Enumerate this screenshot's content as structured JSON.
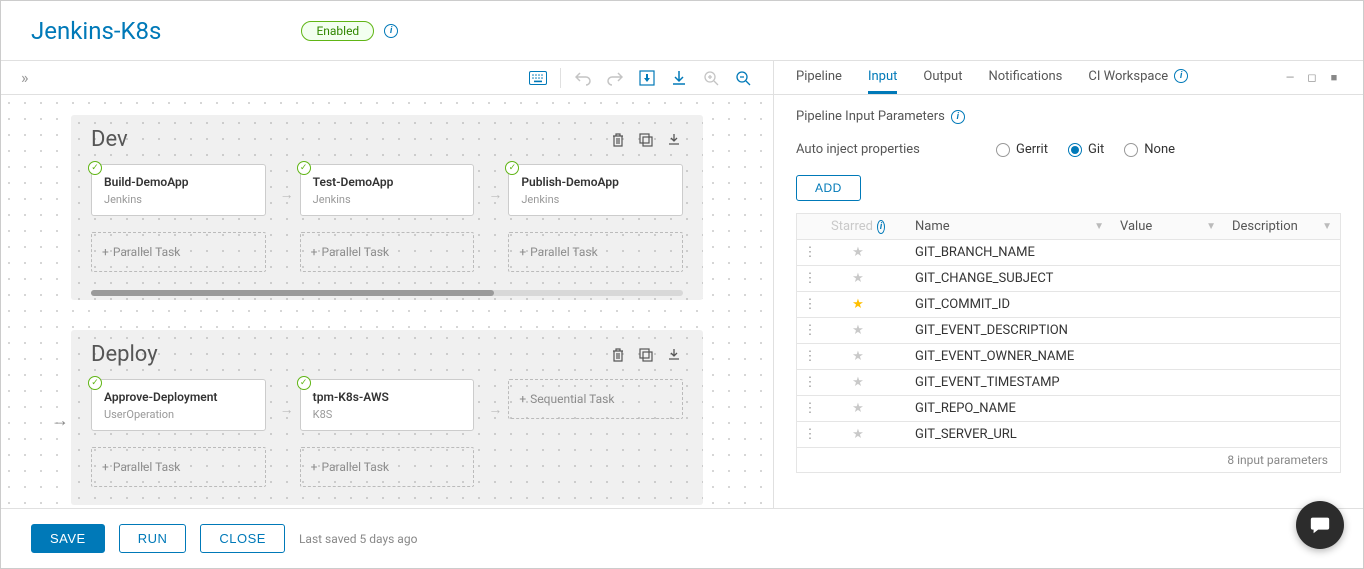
{
  "header": {
    "title": "Jenkins-K8s",
    "status": "Enabled"
  },
  "canvas": {
    "stages": [
      {
        "name": "Dev",
        "columns": [
          {
            "task": {
              "title": "Build-DemoApp",
              "subtitle": "Jenkins"
            },
            "ghost": "Parallel Task"
          },
          {
            "task": {
              "title": "Test-DemoApp",
              "subtitle": "Jenkins"
            },
            "ghost": "Parallel Task"
          },
          {
            "task": {
              "title": "Publish-DemoApp",
              "subtitle": "Jenkins"
            },
            "ghost": "Parallel Task"
          }
        ]
      },
      {
        "name": "Deploy",
        "columns": [
          {
            "task": {
              "title": "Approve-Deployment",
              "subtitle": "UserOperation"
            },
            "ghost": "Parallel Task"
          },
          {
            "task": {
              "title": "tpm-K8s-AWS",
              "subtitle": "K8S"
            },
            "ghost": "Parallel Task"
          },
          {
            "task": null,
            "ghost": "Sequential Task"
          }
        ]
      }
    ]
  },
  "tabs": {
    "items": [
      "Pipeline",
      "Input",
      "Output",
      "Notifications",
      "CI Workspace"
    ],
    "active": 1
  },
  "panel": {
    "section_title": "Pipeline Input Parameters",
    "inject_label": "Auto inject properties",
    "inject_options": [
      "Gerrit",
      "Git",
      "None"
    ],
    "inject_selected": "Git",
    "add_button": "ADD",
    "columns": {
      "starred": "Starred",
      "name": "Name",
      "value": "Value",
      "description": "Description"
    },
    "rows": [
      {
        "starred": false,
        "name": "GIT_BRANCH_NAME"
      },
      {
        "starred": false,
        "name": "GIT_CHANGE_SUBJECT"
      },
      {
        "starred": true,
        "name": "GIT_COMMIT_ID"
      },
      {
        "starred": false,
        "name": "GIT_EVENT_DESCRIPTION"
      },
      {
        "starred": false,
        "name": "GIT_EVENT_OWNER_NAME"
      },
      {
        "starred": false,
        "name": "GIT_EVENT_TIMESTAMP"
      },
      {
        "starred": false,
        "name": "GIT_REPO_NAME"
      },
      {
        "starred": false,
        "name": "GIT_SERVER_URL"
      }
    ],
    "footer": "8 input parameters"
  },
  "footer": {
    "save": "SAVE",
    "run": "RUN",
    "close": "CLOSE",
    "last_saved": "Last saved 5 days ago"
  }
}
